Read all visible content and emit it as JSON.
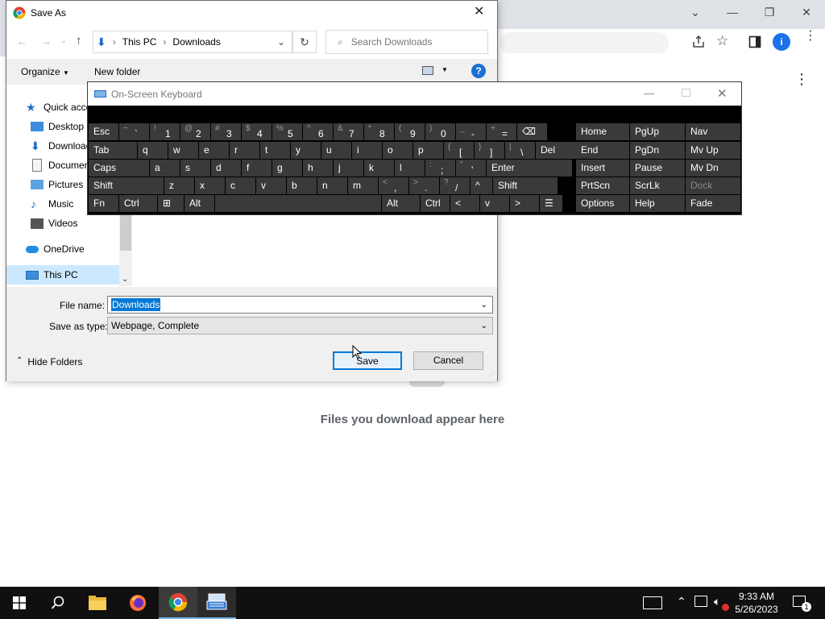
{
  "browser": {
    "window_controls": {
      "minimize": "—",
      "maximize": "❐",
      "close": "✕"
    },
    "profile_initial": "i",
    "empty_message": "Files you download appear here"
  },
  "dialog": {
    "title": "Save As",
    "breadcrumb": [
      "This PC",
      "Downloads"
    ],
    "search_placeholder": "Search Downloads",
    "toolbar": {
      "organize": "Organize",
      "new_folder": "New folder"
    },
    "nav_items": [
      {
        "label": "Quick access",
        "icon": "star-icon"
      },
      {
        "label": "Desktop",
        "icon": "desktop-icon"
      },
      {
        "label": "Downloads",
        "icon": "download-icon"
      },
      {
        "label": "Documents",
        "icon": "document-icon"
      },
      {
        "label": "Pictures",
        "icon": "pictures-icon"
      },
      {
        "label": "Music",
        "icon": "music-icon"
      },
      {
        "label": "Videos",
        "icon": "videos-icon"
      },
      {
        "label": "OneDrive",
        "icon": "cloud-icon"
      },
      {
        "label": "This PC",
        "icon": "computer-icon"
      }
    ],
    "file_name_label": "File name:",
    "file_name_value": "Downloads",
    "save_type_label": "Save as type:",
    "save_type_value": "Webpage, Complete",
    "hide_folders": "Hide Folders",
    "save_button": "Save",
    "cancel_button": "Cancel"
  },
  "osk": {
    "title": "On-Screen Keyboard",
    "row1": [
      {
        "main": "Esc"
      },
      {
        "shift": "~",
        "main": "`"
      },
      {
        "shift": "!",
        "main": "1"
      },
      {
        "shift": "@",
        "main": "2"
      },
      {
        "shift": "#",
        "main": "3"
      },
      {
        "shift": "$",
        "main": "4"
      },
      {
        "shift": "%",
        "main": "5"
      },
      {
        "shift": "^",
        "main": "6"
      },
      {
        "shift": "&",
        "main": "7"
      },
      {
        "shift": "*",
        "main": "8"
      },
      {
        "shift": "(",
        "main": "9"
      },
      {
        "shift": ")",
        "main": "0"
      },
      {
        "shift": "_",
        "main": "-"
      },
      {
        "shift": "+",
        "main": "="
      },
      {
        "main": "⌫"
      }
    ],
    "row2": [
      "Tab",
      "q",
      "w",
      "e",
      "r",
      "t",
      "y",
      "u",
      "i",
      "o",
      "p",
      "[",
      "]",
      "\\",
      "Del"
    ],
    "row2_shift": {
      "11": "{",
      "12": "}",
      "13": "|"
    },
    "row3": [
      "Caps",
      "a",
      "s",
      "d",
      "f",
      "g",
      "h",
      "j",
      "k",
      "l",
      ";",
      "'",
      "Enter"
    ],
    "row3_shift": {
      "10": ":",
      "11": "\""
    },
    "row4": [
      "Shift",
      "z",
      "x",
      "c",
      "v",
      "b",
      "n",
      "m",
      ",",
      ".",
      "/",
      "^",
      "Shift"
    ],
    "row4_shift": {
      "8": "<",
      "9": ">",
      "10": "?"
    },
    "row5": [
      "Fn",
      "Ctrl",
      "⊞",
      "Alt",
      "",
      "Alt",
      "Ctrl",
      "<",
      "v",
      ">",
      "☰"
    ],
    "nav_keys": [
      [
        "Home",
        "PgUp",
        "Nav"
      ],
      [
        "End",
        "PgDn",
        "Mv Up"
      ],
      [
        "Insert",
        "Pause",
        "Mv Dn"
      ],
      [
        "PrtScn",
        "ScrLk",
        "Dock"
      ],
      [
        "Options",
        "Help",
        "Fade"
      ]
    ]
  },
  "taskbar": {
    "time": "9:33 AM",
    "date": "5/26/2023",
    "notification_count": "1"
  },
  "colors": {
    "accent": "#0078d7",
    "chrome_blue": "#1a73e8",
    "taskbar": "#101010"
  }
}
